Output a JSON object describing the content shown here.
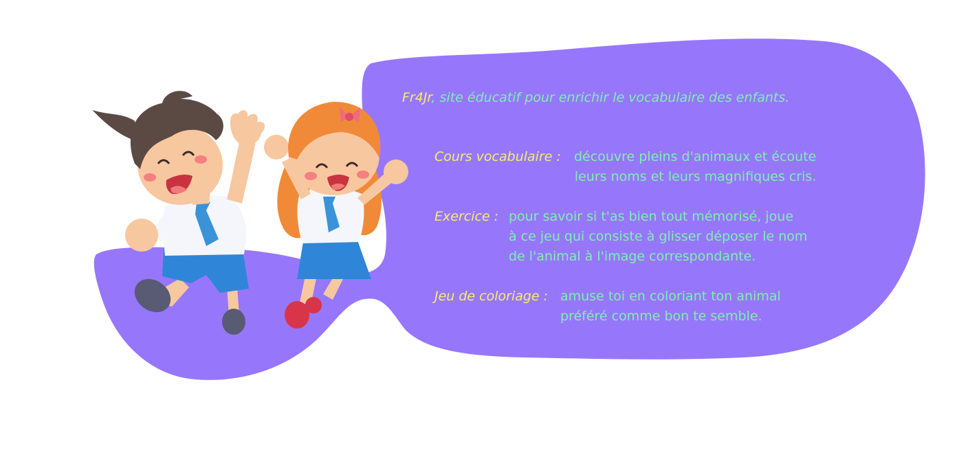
{
  "intro": {
    "brand": "Fr4Jr",
    "tagline": ", site éducatif pour enrichir le vocabulaire des enfants."
  },
  "sections": [
    {
      "title": "Cours vocabulaire :",
      "description": "découvre pleins d'animaux et écoute\nleurs noms et leurs magnifiques cris."
    },
    {
      "title": "Exercice :",
      "description": "pour savoir si t'as bien tout mémorisé, joue\nà ce jeu qui consiste à glisser déposer le nom\nde l'animal à l'image correspondante."
    },
    {
      "title": "Jeu de coloriage :",
      "description": "amuse toi en coloriant ton animal\npréféré comme bon te semble."
    }
  ],
  "colors": {
    "blob": "#9677fb",
    "title_yellow": "#f6ee6e",
    "text_green": "#7ef0b0"
  },
  "illustration": {
    "characters": [
      "boy-character",
      "girl-character"
    ]
  }
}
